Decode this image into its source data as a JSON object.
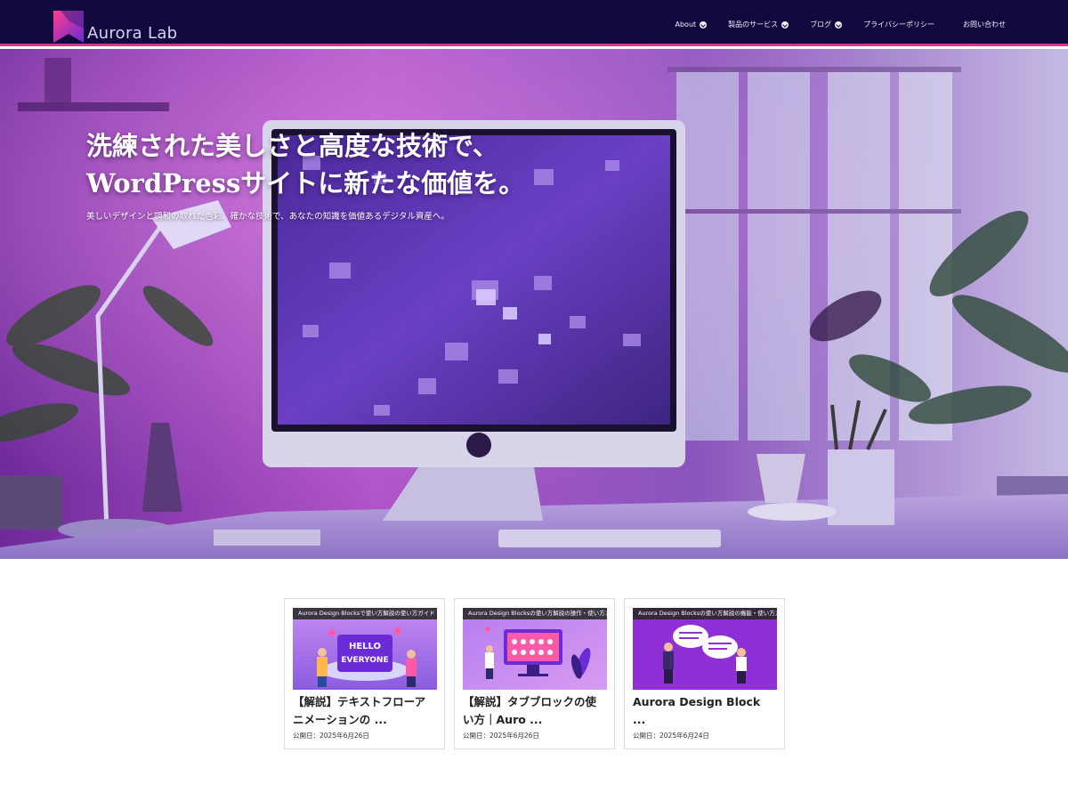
{
  "header": {
    "logo_text": "Aurora Lab",
    "nav": [
      {
        "label": "About",
        "has_dropdown": true
      },
      {
        "label": "製品のサービス",
        "has_dropdown": true
      },
      {
        "label": "ブログ",
        "has_dropdown": true
      },
      {
        "label": "プライバシーポリシー",
        "has_dropdown": false
      },
      {
        "label": "お問い合わせ",
        "has_dropdown": false
      }
    ]
  },
  "hero": {
    "title_line1": "洗練された美しさと高度な技術で、",
    "title_line2": "WordPressサイトに新たな価値を。",
    "subtitle": "美しいデザインと調和の取れた色彩、確かな技術で、あなたの知識を価値あるデジタル資産へ。"
  },
  "cards": [
    {
      "tag": "Aurora Design Blocksで使い方解説の使い方ガイド",
      "thumb_text_1": "HELLO",
      "thumb_text_2": "EVERYONE",
      "title": "【解説】テキストフローアニメーションの ...",
      "date": "公開日：2025年6月26日"
    },
    {
      "tag": "Aurora Design Blocksの使い方解説の操作・使い方ガイド",
      "title": "【解説】タブブロックの使い方｜Auro ...",
      "date": "公開日：2025年6月26日"
    },
    {
      "tag": "Aurora Design Blocksの使い方解説の機能・使い方ガイド",
      "title": "Aurora Design Block ...",
      "date": "公開日：2025年6月24日"
    }
  ],
  "colors": {
    "header_bg": "#120a3e",
    "accent": "#e0338a",
    "card_thumb_purple": "#8f2fd6"
  }
}
